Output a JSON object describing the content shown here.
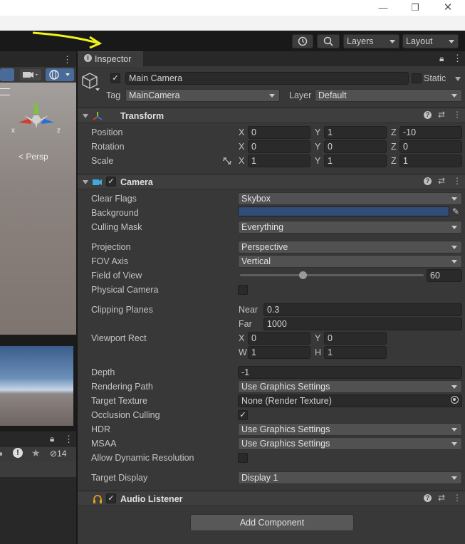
{
  "window": {
    "minimize": "—",
    "maximize": "❐",
    "close": "✕"
  },
  "toolbar": {
    "layers_label": "Layers",
    "layout_label": "Layout"
  },
  "scene": {
    "persp_label": "Persp",
    "gizmo_y": "y",
    "gizmo_x": "x",
    "gizmo_z": "z"
  },
  "project": {
    "hidden_count": "14"
  },
  "inspector": {
    "tab_label": "Inspector",
    "object_name": "Main Camera",
    "static_label": "Static",
    "tag_label": "Tag",
    "tag_value": "MainCamera",
    "layer_label": "Layer",
    "layer_value": "Default",
    "active_checked": true
  },
  "transform": {
    "title": "Transform",
    "rows": [
      {
        "label": "Position",
        "x": "0",
        "y": "1",
        "z": "-10"
      },
      {
        "label": "Rotation",
        "x": "0",
        "y": "0",
        "z": "0"
      },
      {
        "label": "Scale",
        "x": "1",
        "y": "1",
        "z": "1"
      }
    ],
    "axis_x": "X",
    "axis_y": "Y",
    "axis_z": "Z"
  },
  "camera": {
    "title": "Camera",
    "clear_flags_label": "Clear Flags",
    "clear_flags_value": "Skybox",
    "background_label": "Background",
    "background_color": "#314d79",
    "culling_mask_label": "Culling Mask",
    "culling_mask_value": "Everything",
    "projection_label": "Projection",
    "projection_value": "Perspective",
    "fov_axis_label": "FOV Axis",
    "fov_axis_value": "Vertical",
    "fov_label": "Field of View",
    "fov_value": "60",
    "fov_slider_fraction": 0.34,
    "physical_label": "Physical Camera",
    "clipping_label": "Clipping Planes",
    "near_label": "Near",
    "near_value": "0.3",
    "far_label": "Far",
    "far_value": "1000",
    "viewport_label": "Viewport Rect",
    "vx_label": "X",
    "vx_value": "0",
    "vy_label": "Y",
    "vy_value": "0",
    "vw_label": "W",
    "vw_value": "1",
    "vh_label": "H",
    "vh_value": "1",
    "depth_label": "Depth",
    "depth_value": "-1",
    "rendering_path_label": "Rendering Path",
    "rendering_path_value": "Use Graphics Settings",
    "target_texture_label": "Target Texture",
    "target_texture_value": "None (Render Texture)",
    "occlusion_label": "Occlusion Culling",
    "hdr_label": "HDR",
    "hdr_value": "Use Graphics Settings",
    "msaa_label": "MSAA",
    "msaa_value": "Use Graphics Settings",
    "dynres_label": "Allow Dynamic Resolution",
    "target_display_label": "Target Display",
    "target_display_value": "Display 1"
  },
  "audio_listener": {
    "title": "Audio Listener"
  },
  "add_component_label": "Add Component"
}
